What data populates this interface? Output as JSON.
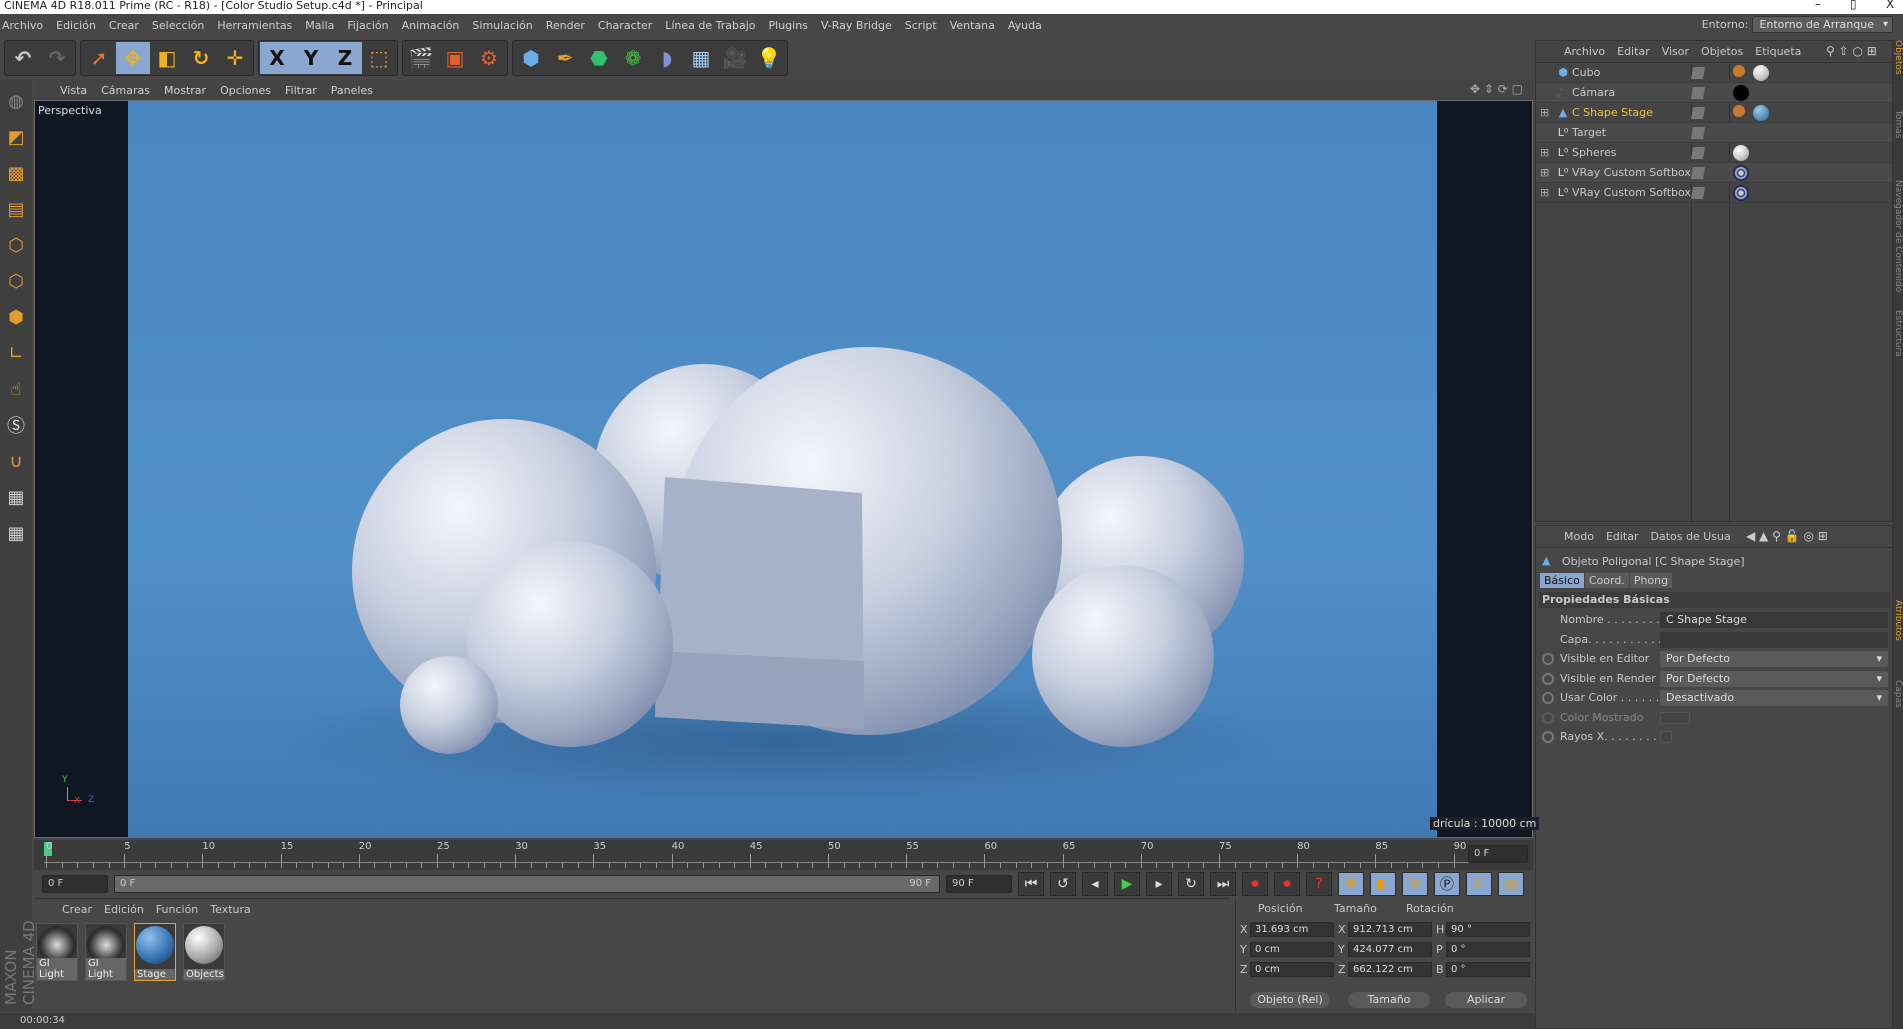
{
  "window": {
    "title": "CINEMA 4D R18.011 Prime (RC - R18) - [Color Studio Setup.c4d *] - Principal",
    "minimize": "–",
    "restore": "▯",
    "close": "X"
  },
  "menu": [
    "Archivo",
    "Edición",
    "Crear",
    "Selección",
    "Herramientas",
    "Malla",
    "Fijación",
    "Animación",
    "Simulación",
    "Render",
    "Character",
    "Línea de Trabajo",
    "Plugins",
    "V-Ray Bridge",
    "Script",
    "Ventana",
    "Ayuda"
  ],
  "environment": {
    "label": "Entorno:",
    "value": "Entorno de Arranque"
  },
  "toolbar": {
    "icons": [
      "undo-icon",
      "redo-icon",
      "select-icon",
      "move-icon",
      "scale-icon",
      "rotate-icon",
      "last-tool-icon",
      "x-axis-icon",
      "y-axis-icon",
      "z-axis-icon",
      "coordinate-system-icon",
      "render-view-icon",
      "render-picture-viewer-icon",
      "render-settings-icon",
      "cube-icon",
      "pen-icon",
      "subdivision-icon",
      "mograph-cloner-icon",
      "deformer-icon",
      "floor-icon",
      "camera-icon",
      "light-icon"
    ],
    "axis_labels": [
      "X",
      "Y",
      "Z"
    ]
  },
  "viewport": {
    "menu": [
      "Vista",
      "Cámaras",
      "Mostrar",
      "Opciones",
      "Filtrar",
      "Paneles"
    ],
    "label": "Perspectiva",
    "grid": "drícula : 10000 cm",
    "axes": {
      "y": "Y",
      "x": "X",
      "z": "Z"
    },
    "background": "#4a86c0"
  },
  "timeline": {
    "ticks": [
      0,
      5,
      10,
      15,
      20,
      25,
      30,
      35,
      40,
      45,
      50,
      55,
      60,
      65,
      70,
      75,
      80,
      85,
      90
    ],
    "current_frame": "0 F",
    "start": "0 F",
    "range_start": "0 F",
    "range_end": "90 F",
    "end": "90 F"
  },
  "materials": {
    "menu": [
      "Crear",
      "Edición",
      "Función",
      "Textura"
    ],
    "items": [
      {
        "name": "GI Light"
      },
      {
        "name": "GI Light"
      },
      {
        "name": "Stage"
      },
      {
        "name": "Objects"
      }
    ]
  },
  "logo": "MAXON CINEMA 4D",
  "coords": {
    "headers": [
      "Posición",
      "Tamaño",
      "Rotación"
    ],
    "position": [
      {
        "axis": "X",
        "value": "31.693 cm"
      },
      {
        "axis": "Y",
        "value": "0 cm"
      },
      {
        "axis": "Z",
        "value": "0 cm"
      }
    ],
    "size": [
      {
        "axis": "X",
        "value": "912.713 cm"
      },
      {
        "axis": "Y",
        "value": "424.077 cm"
      },
      {
        "axis": "Z",
        "value": "662.122 cm"
      }
    ],
    "rotation": [
      {
        "axis": "H",
        "value": "90 °"
      },
      {
        "axis": "P",
        "value": "0 °"
      },
      {
        "axis": "B",
        "value": "0 °"
      }
    ],
    "mode": "Objeto (Rel)",
    "size_mode": "Tamaño",
    "apply": "Aplicar"
  },
  "status": "00:00:34",
  "objects": {
    "menu": [
      "Archivo",
      "Editar",
      "Visor",
      "Objetos",
      "Etiqueta"
    ],
    "items": [
      {
        "name": "Cubo",
        "icon": "cube-icon"
      },
      {
        "name": "Cámara",
        "icon": "camera-icon"
      },
      {
        "name": "C Shape Stage",
        "icon": "polygon-icon",
        "selected": true
      },
      {
        "name": "Target",
        "icon": "null-icon"
      },
      {
        "name": "Spheres",
        "icon": "null-icon"
      },
      {
        "name": "VRay Custom Softbox",
        "icon": "null-icon"
      },
      {
        "name": "VRay Custom Softbox",
        "icon": "null-icon"
      }
    ]
  },
  "attributes": {
    "menu": [
      "Modo",
      "Editar",
      "Datos de Usua"
    ],
    "object_title": "Objeto Poligonal [C Shape Stage]",
    "tabs": [
      "Básico",
      "Coord.",
      "Phong"
    ],
    "section": "Propiedades Básicas",
    "fields": [
      {
        "label": "Nombre . . . . . . . . .",
        "value": "C Shape Stage"
      },
      {
        "label": "Capa. . . . . . . . . . .",
        "value": ""
      },
      {
        "label": "Visible en Editor",
        "value": "Por Defecto"
      },
      {
        "label": "Visible en Render",
        "value": "Por Defecto"
      },
      {
        "label": "Usar Color . . . . . .",
        "value": "Desactivado"
      },
      {
        "label": "Color Mostrado",
        "value": ""
      },
      {
        "label": "Rayos X. . . . . . . . .",
        "value": ""
      }
    ]
  },
  "side_tabs": [
    "Objetos",
    "Tomas",
    "Navegador de Contenido",
    "Estructura",
    "Atributos",
    "Capas"
  ],
  "colors": {
    "accent": "#e3a43a",
    "selected_blue": "#8aa8cf",
    "selected_object": "#f0c040"
  }
}
